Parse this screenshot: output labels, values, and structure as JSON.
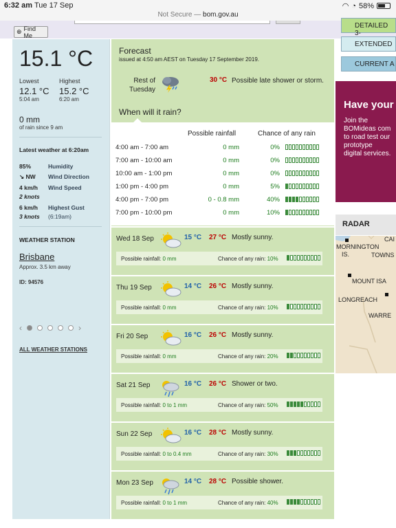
{
  "status": {
    "time": "6:32 am",
    "date": "Tue 17 Sep",
    "battery": "58%"
  },
  "url": {
    "prefix": "Not Secure — ",
    "domain": "bom.gov.au"
  },
  "find_me": "Find Me",
  "current": {
    "temp": "15.1 °C",
    "lowest_label": "Lowest",
    "lowest": "12.1 °C",
    "lowest_time": "5:04 am",
    "highest_label": "Highest",
    "highest": "15.2 °C",
    "highest_time": "6:20 am",
    "rain": "0 mm",
    "rain_note": "of rain since 9 am",
    "latest_title": "Latest weather at 6:20am",
    "humidity": "85%",
    "humidity_label": "Humidity",
    "wind_dir": "NW",
    "wind_dir_label": "Wind Direction",
    "wind_speed": "4 km/h",
    "wind_speed_kn": "2 knots",
    "wind_speed_label": "Wind Speed",
    "gust": "6 km/h",
    "gust_kn": "3 knots",
    "gust_label": "Highest Gust",
    "gust_time": "(6:19am)",
    "station_title": "WEATHER STATION",
    "station": "Brisbane",
    "station_dist": "Approx. 3.5 km away",
    "station_id": "ID: 94576",
    "all_stations": "ALL WEATHER STATIONS"
  },
  "forecast": {
    "title": "Forecast",
    "issued": "issued at 4:50 am AEST on Tuesday 17 September 2019.",
    "rest_label": "Rest of Tuesday",
    "rest_max": "30 °C",
    "rest_desc": "Possible late shower or storm.",
    "when_rain": "When will it rain?",
    "col_rain": "Possible rainfall",
    "col_chance": "Chance of any rain",
    "hours": [
      {
        "t": "4:00 am - 7:00 am",
        "r": "0 mm",
        "c": "0%",
        "pct": 0
      },
      {
        "t": "7:00 am - 10:00 am",
        "r": "0 mm",
        "c": "0%",
        "pct": 0
      },
      {
        "t": "10:00 am - 1:00 pm",
        "r": "0 mm",
        "c": "0%",
        "pct": 0
      },
      {
        "t": "1:00 pm - 4:00 pm",
        "r": "0 mm",
        "c": "5%",
        "pct": 5
      },
      {
        "t": "4:00 pm - 7:00 pm",
        "r": "0 - 0.8 mm",
        "c": "40%",
        "pct": 40
      },
      {
        "t": "7:00 pm - 10:00 pm",
        "r": "0 mm",
        "c": "10%",
        "pct": 10
      }
    ],
    "days": [
      {
        "name": "Wed 18 Sep",
        "min": "15 °C",
        "max": "27 °C",
        "desc": "Mostly sunny.",
        "icon": "mostly-sunny",
        "pr_label": "Possible rainfall:",
        "pr": "0 mm",
        "ch_label": "Chance of any rain:",
        "ch": "10%",
        "pct": 10
      },
      {
        "name": "Thu 19 Sep",
        "min": "14 °C",
        "max": "26 °C",
        "desc": "Mostly sunny.",
        "icon": "mostly-sunny",
        "pr_label": "Possible rainfall:",
        "pr": "0 mm",
        "ch_label": "Chance of any rain:",
        "ch": "10%",
        "pct": 10
      },
      {
        "name": "Fri 20 Sep",
        "min": "16 °C",
        "max": "26 °C",
        "desc": "Mostly sunny.",
        "icon": "mostly-sunny",
        "pr_label": "Possible rainfall:",
        "pr": "0 mm",
        "ch_label": "Chance of any rain:",
        "ch": "20%",
        "pct": 20
      },
      {
        "name": "Sat 21 Sep",
        "min": "16 °C",
        "max": "26 °C",
        "desc": "Shower or two.",
        "icon": "showers",
        "pr_label": "Possible rainfall:",
        "pr": "0 to 1 mm",
        "ch_label": "Chance of any rain:",
        "ch": "50%",
        "pct": 50
      },
      {
        "name": "Sun 22 Sep",
        "min": "16 °C",
        "max": "28 °C",
        "desc": "Mostly sunny.",
        "icon": "mostly-sunny",
        "pr_label": "Possible rainfall:",
        "pr": "0 to 0.4 mm",
        "ch_label": "Chance of any rain:",
        "ch": "30%",
        "pct": 30
      },
      {
        "name": "Mon 23 Sep",
        "min": "14 °C",
        "max": "28 °C",
        "desc": "Possible shower.",
        "icon": "possible-shower",
        "pr_label": "Possible rainfall:",
        "pr": "0 to 1 mm",
        "ch_label": "Chance of any rain:",
        "ch": "40%",
        "pct": 40
      }
    ]
  },
  "right": {
    "tab_detailed": "DETAILED 3-",
    "tab_extended": "EXTENDED",
    "tab_current": "CURRENT A",
    "ad_title": "Have your",
    "ad_lines": [
      "Join the",
      "BOMideas com",
      "to road test our",
      "prototype",
      "digital services."
    ],
    "radar_title": "RADAR",
    "radar_labels": [
      "MORNINGTON",
      "IS.",
      "TOWNS",
      "CAI",
      "MOUNT ISA",
      "LONGREACH",
      "WARRE"
    ]
  },
  "colors": {
    "forecast_bg": "#cfe3b6",
    "side_bg": "#d7e8ed",
    "max_temp": "#b00000",
    "min_temp": "#1f5fa8",
    "ad_bg": "#8a1a4e"
  }
}
